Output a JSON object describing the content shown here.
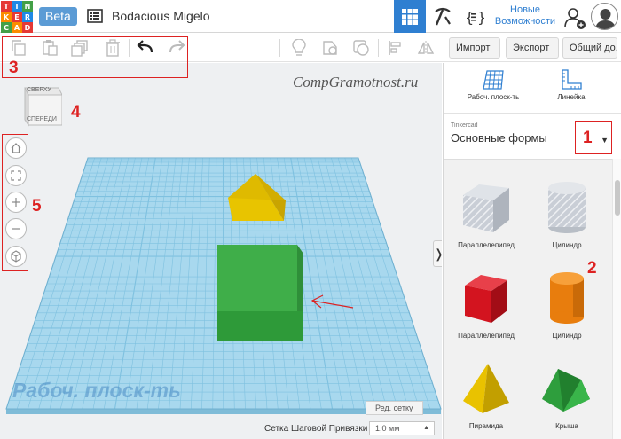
{
  "logo": {
    "letters": [
      "T",
      "I",
      "N",
      "K",
      "E",
      "R",
      "C",
      "A",
      "D"
    ],
    "colors": [
      "#e53935",
      "#1e88e5",
      "#43a047",
      "#fb8c00",
      "#e53935",
      "#1e88e5",
      "#43a047",
      "#fb8c00",
      "#e53935"
    ]
  },
  "header": {
    "beta_label": "Beta",
    "doc_title": "Bodacious Migelo",
    "news_label": "Новые Возможности",
    "accent": "#2f7fd1"
  },
  "toolbar": {
    "import_label": "Импорт",
    "export_label": "Экспорт",
    "share_label": "Общий до..."
  },
  "workspace": {
    "watermark": "CompGramotnost.ru",
    "viewcube_top": "СВЕРХУ",
    "viewcube_front": "СПЕРЕДИ",
    "workplane_label": "Рабоч. плоск-ть",
    "edit_grid_label": "Ред. сетку",
    "snap_label": "Сетка Шаговой Привязки",
    "snap_value": "1,0 мм"
  },
  "panel": {
    "tab_workplane": "Рабоч. плоск-ть",
    "tab_ruler": "Линейка",
    "library_small": "Tinkercad",
    "library_name": "Основные формы",
    "shapes": [
      {
        "name": "box-hole",
        "label": "Параллелепипед"
      },
      {
        "name": "cylinder-hole",
        "label": "Цилиндр"
      },
      {
        "name": "box-red",
        "label": "Параллелепипед"
      },
      {
        "name": "cylinder-orange",
        "label": "Цилиндр"
      },
      {
        "name": "pyramid",
        "label": "Пирамида"
      },
      {
        "name": "roof",
        "label": "Крыша"
      }
    ]
  },
  "annotations": {
    "n1": "1",
    "n2": "2",
    "n3": "3",
    "n4": "4",
    "n5": "5",
    "color": "#dd2222"
  }
}
